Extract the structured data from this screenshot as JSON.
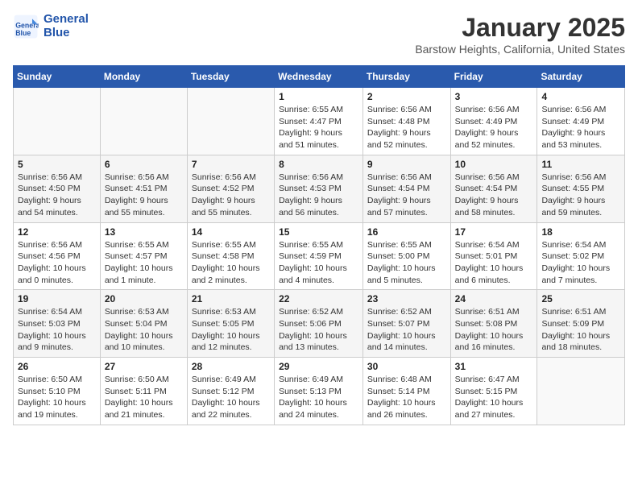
{
  "header": {
    "logo_line1": "General",
    "logo_line2": "Blue",
    "month": "January 2025",
    "location": "Barstow Heights, California, United States"
  },
  "days_of_week": [
    "Sunday",
    "Monday",
    "Tuesday",
    "Wednesday",
    "Thursday",
    "Friday",
    "Saturday"
  ],
  "weeks": [
    [
      {
        "day": "",
        "info": ""
      },
      {
        "day": "",
        "info": ""
      },
      {
        "day": "",
        "info": ""
      },
      {
        "day": "1",
        "info": "Sunrise: 6:55 AM\nSunset: 4:47 PM\nDaylight: 9 hours and 51 minutes."
      },
      {
        "day": "2",
        "info": "Sunrise: 6:56 AM\nSunset: 4:48 PM\nDaylight: 9 hours and 52 minutes."
      },
      {
        "day": "3",
        "info": "Sunrise: 6:56 AM\nSunset: 4:49 PM\nDaylight: 9 hours and 52 minutes."
      },
      {
        "day": "4",
        "info": "Sunrise: 6:56 AM\nSunset: 4:49 PM\nDaylight: 9 hours and 53 minutes."
      }
    ],
    [
      {
        "day": "5",
        "info": "Sunrise: 6:56 AM\nSunset: 4:50 PM\nDaylight: 9 hours and 54 minutes."
      },
      {
        "day": "6",
        "info": "Sunrise: 6:56 AM\nSunset: 4:51 PM\nDaylight: 9 hours and 55 minutes."
      },
      {
        "day": "7",
        "info": "Sunrise: 6:56 AM\nSunset: 4:52 PM\nDaylight: 9 hours and 55 minutes."
      },
      {
        "day": "8",
        "info": "Sunrise: 6:56 AM\nSunset: 4:53 PM\nDaylight: 9 hours and 56 minutes."
      },
      {
        "day": "9",
        "info": "Sunrise: 6:56 AM\nSunset: 4:54 PM\nDaylight: 9 hours and 57 minutes."
      },
      {
        "day": "10",
        "info": "Sunrise: 6:56 AM\nSunset: 4:54 PM\nDaylight: 9 hours and 58 minutes."
      },
      {
        "day": "11",
        "info": "Sunrise: 6:56 AM\nSunset: 4:55 PM\nDaylight: 9 hours and 59 minutes."
      }
    ],
    [
      {
        "day": "12",
        "info": "Sunrise: 6:56 AM\nSunset: 4:56 PM\nDaylight: 10 hours and 0 minutes."
      },
      {
        "day": "13",
        "info": "Sunrise: 6:55 AM\nSunset: 4:57 PM\nDaylight: 10 hours and 1 minute."
      },
      {
        "day": "14",
        "info": "Sunrise: 6:55 AM\nSunset: 4:58 PM\nDaylight: 10 hours and 2 minutes."
      },
      {
        "day": "15",
        "info": "Sunrise: 6:55 AM\nSunset: 4:59 PM\nDaylight: 10 hours and 4 minutes."
      },
      {
        "day": "16",
        "info": "Sunrise: 6:55 AM\nSunset: 5:00 PM\nDaylight: 10 hours and 5 minutes."
      },
      {
        "day": "17",
        "info": "Sunrise: 6:54 AM\nSunset: 5:01 PM\nDaylight: 10 hours and 6 minutes."
      },
      {
        "day": "18",
        "info": "Sunrise: 6:54 AM\nSunset: 5:02 PM\nDaylight: 10 hours and 7 minutes."
      }
    ],
    [
      {
        "day": "19",
        "info": "Sunrise: 6:54 AM\nSunset: 5:03 PM\nDaylight: 10 hours and 9 minutes."
      },
      {
        "day": "20",
        "info": "Sunrise: 6:53 AM\nSunset: 5:04 PM\nDaylight: 10 hours and 10 minutes."
      },
      {
        "day": "21",
        "info": "Sunrise: 6:53 AM\nSunset: 5:05 PM\nDaylight: 10 hours and 12 minutes."
      },
      {
        "day": "22",
        "info": "Sunrise: 6:52 AM\nSunset: 5:06 PM\nDaylight: 10 hours and 13 minutes."
      },
      {
        "day": "23",
        "info": "Sunrise: 6:52 AM\nSunset: 5:07 PM\nDaylight: 10 hours and 14 minutes."
      },
      {
        "day": "24",
        "info": "Sunrise: 6:51 AM\nSunset: 5:08 PM\nDaylight: 10 hours and 16 minutes."
      },
      {
        "day": "25",
        "info": "Sunrise: 6:51 AM\nSunset: 5:09 PM\nDaylight: 10 hours and 18 minutes."
      }
    ],
    [
      {
        "day": "26",
        "info": "Sunrise: 6:50 AM\nSunset: 5:10 PM\nDaylight: 10 hours and 19 minutes."
      },
      {
        "day": "27",
        "info": "Sunrise: 6:50 AM\nSunset: 5:11 PM\nDaylight: 10 hours and 21 minutes."
      },
      {
        "day": "28",
        "info": "Sunrise: 6:49 AM\nSunset: 5:12 PM\nDaylight: 10 hours and 22 minutes."
      },
      {
        "day": "29",
        "info": "Sunrise: 6:49 AM\nSunset: 5:13 PM\nDaylight: 10 hours and 24 minutes."
      },
      {
        "day": "30",
        "info": "Sunrise: 6:48 AM\nSunset: 5:14 PM\nDaylight: 10 hours and 26 minutes."
      },
      {
        "day": "31",
        "info": "Sunrise: 6:47 AM\nSunset: 5:15 PM\nDaylight: 10 hours and 27 minutes."
      },
      {
        "day": "",
        "info": ""
      }
    ]
  ]
}
